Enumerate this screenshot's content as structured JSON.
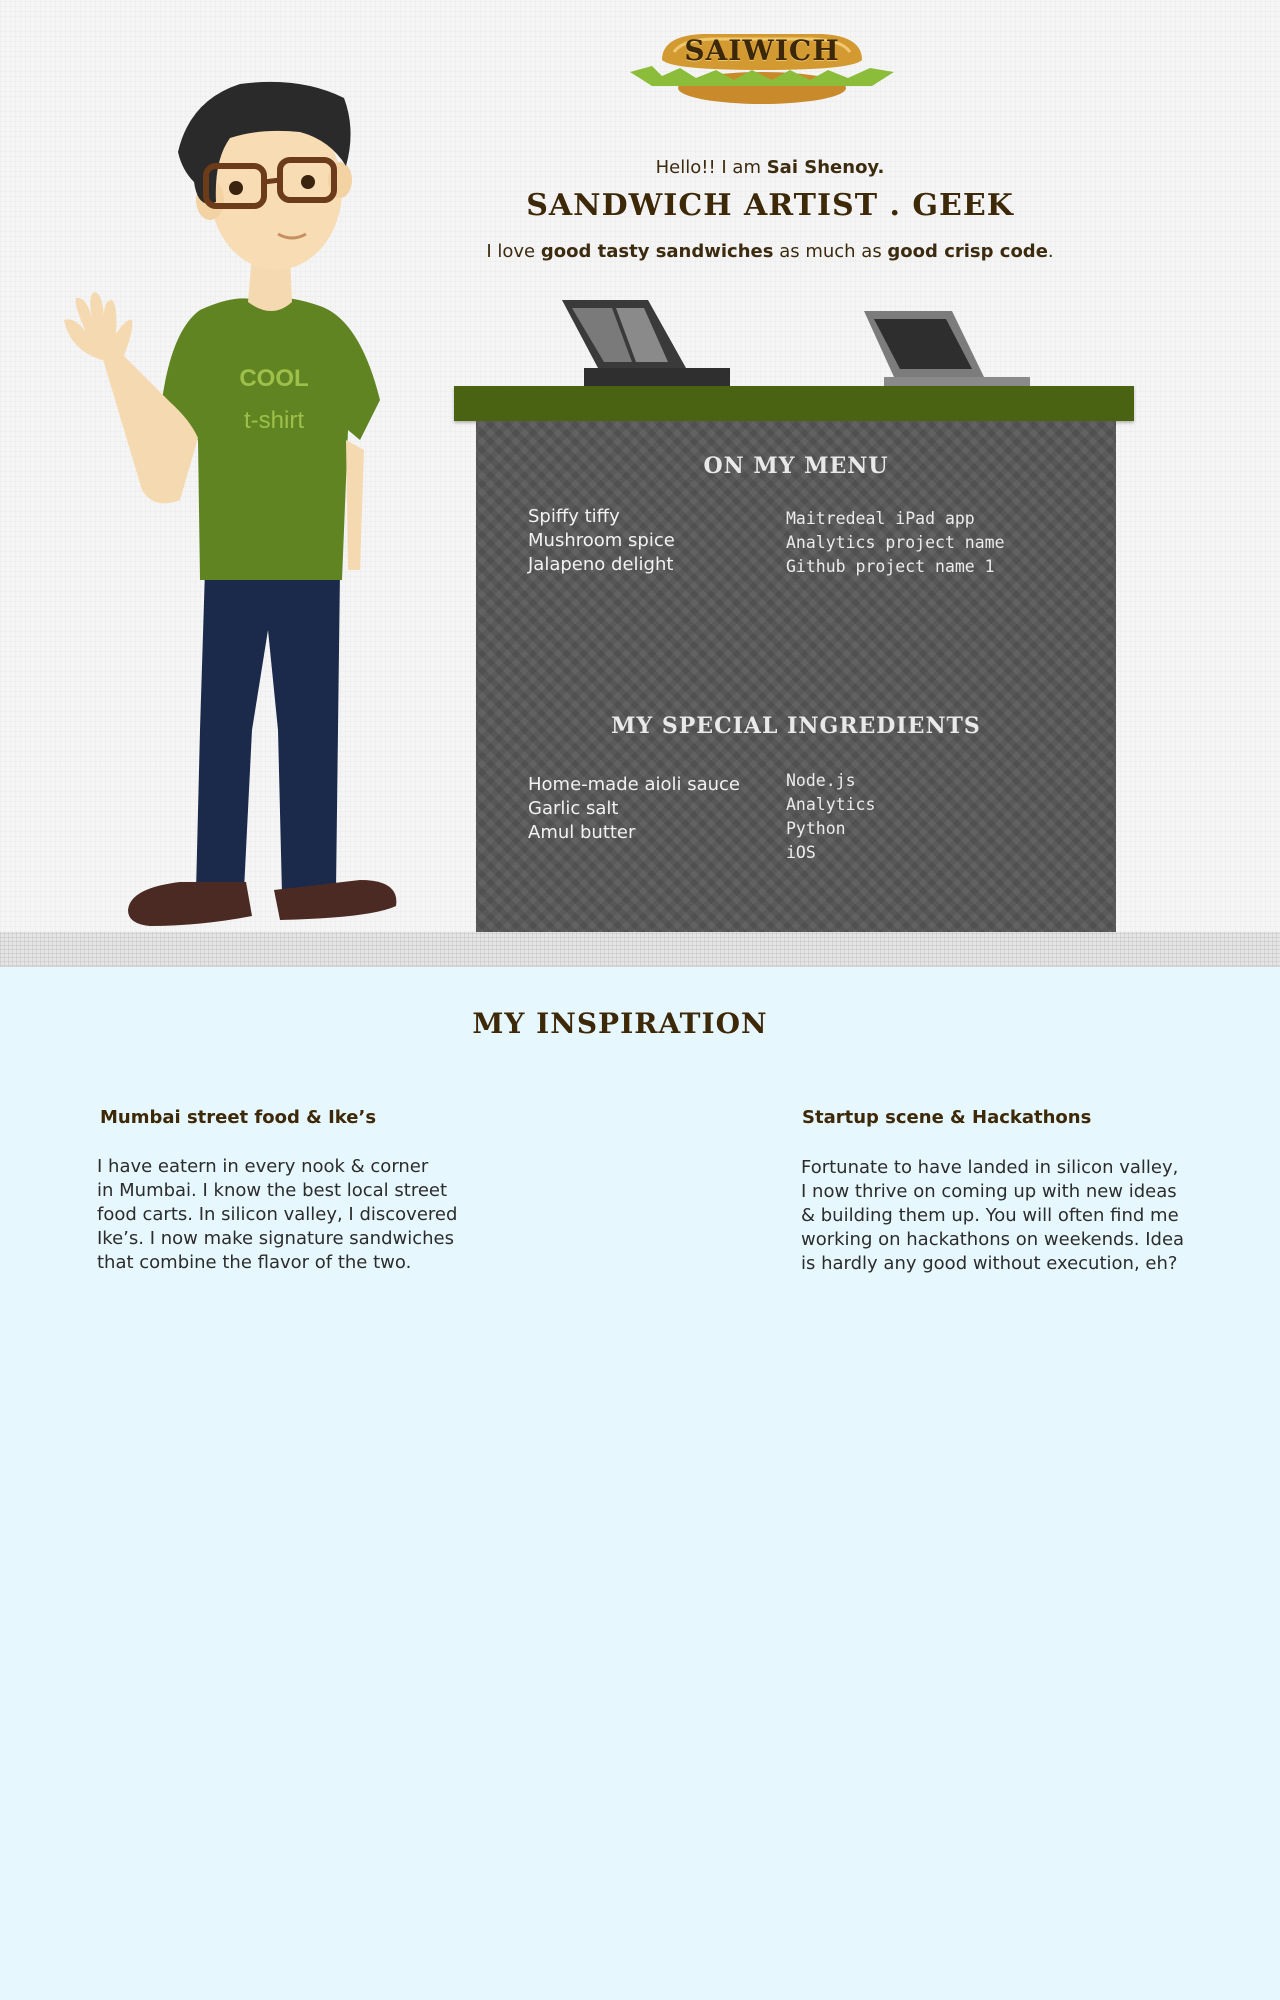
{
  "logo": {
    "text": "SAIWICH"
  },
  "hero": {
    "greeting": "Hello!!  I am ",
    "name": "Sai Shenoy.",
    "tagline": "SANDWICH ARTIST . GEEK",
    "love_prefix": "I love ",
    "love_strong_1": "good tasty sandwiches",
    "love_middle": " as much as ",
    "love_strong_2": "good crisp code",
    "love_suffix": "."
  },
  "character": {
    "shirt_line_1": "COOL",
    "shirt_line_2": "t-shirt"
  },
  "menu": {
    "title": "ON MY MENU",
    "sandwiches": [
      "Spiffy tiffy",
      "Mushroom spice",
      "Jalapeno delight"
    ],
    "projects": [
      "Maitredeal iPad app",
      "Analytics project name",
      "Github project name 1"
    ]
  },
  "ingredients": {
    "title": "MY SPECIAL INGREDIENTS",
    "food": [
      "Home-made aioli sauce",
      "Garlic salt",
      "Amul butter"
    ],
    "tech": [
      "Node.js",
      "Analytics",
      "Python",
      "iOS"
    ]
  },
  "inspiration": {
    "title": "MY INSPIRATION",
    "items": [
      {
        "heading": "Mumbai street food & Ike’s",
        "lines": [
          "I have eatern in every nook & corner",
          "in Mumbai. I know the best local street",
          "food carts. In silicon valley, I discovered",
          "Ike’s. I now make signature sandwiches",
          "that combine the flavor of the two."
        ]
      },
      {
        "heading": "Startup scene & Hackathons",
        "lines": [
          "Fortunate to have landed in silicon valley,",
          "I now thrive on coming up with new ideas",
          "& building them up. You will often find me",
          "working on hackathons on weekends. Idea",
          "is hardly any good without execution, eh?"
        ]
      }
    ]
  },
  "colors": {
    "brown_text": "#3d2808",
    "counter_green": "#4a6312",
    "counter_gray": "#575757",
    "inspiration_bg": "#e6f7fe"
  }
}
